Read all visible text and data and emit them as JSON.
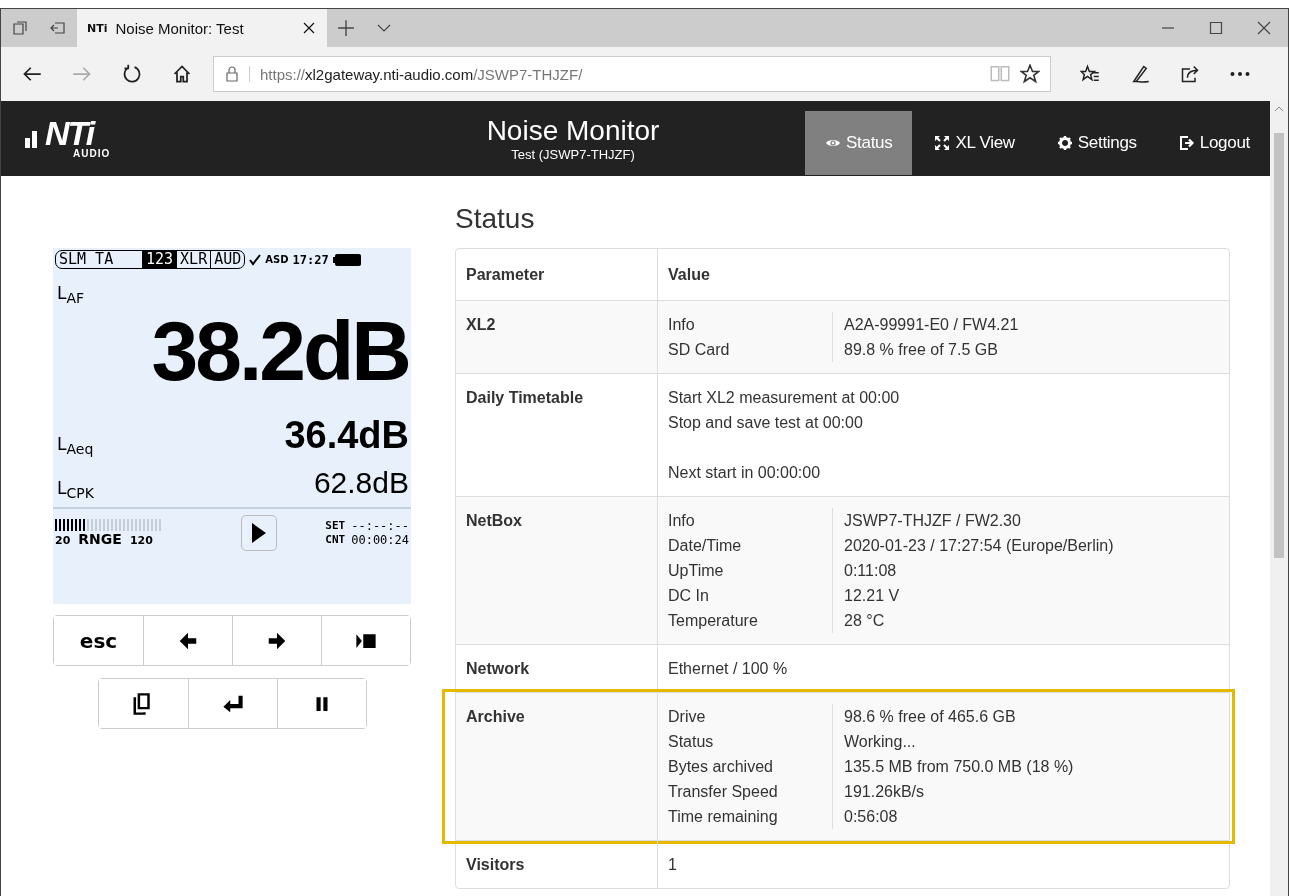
{
  "browser": {
    "tab_title": "Noise Monitor: Test",
    "tab_favicon": "NTi",
    "url": {
      "scheme": "https://",
      "host": "xl2gateway.nti-audio.com",
      "path": "/JSWP7-THJZF/"
    }
  },
  "header": {
    "logo": "NTi",
    "logo_sub": "AUDIO",
    "title": "Noise Monitor",
    "subtitle": "Test (JSWP7-THJZF)",
    "nav": [
      {
        "label": "Status",
        "kind": "eye",
        "selected": true
      },
      {
        "label": "XL View",
        "kind": "expand",
        "selected": false
      },
      {
        "label": "Settings",
        "kind": "gear",
        "selected": false
      },
      {
        "label": "Logout",
        "kind": "logout",
        "selected": false
      }
    ]
  },
  "device": {
    "status_segments": [
      {
        "label": "SLM TA",
        "selected": false
      },
      {
        "label": "123",
        "selected": true
      },
      {
        "label": "XLR",
        "selected": false
      },
      {
        "label": "AUD",
        "selected": false
      }
    ],
    "asd": "ASD",
    "clock": "17:27",
    "readings": [
      {
        "label": "L$_{AF}$",
        "value": "38.2dB",
        "kind": "primary"
      },
      {
        "label": "L$_{Aeq}$",
        "value": "36.4dB",
        "kind": "secondary"
      },
      {
        "label": "L$_{CPK}$",
        "value": "62.8dB",
        "kind": "tertiary"
      }
    ],
    "range": {
      "level": 0.3,
      "low": "20",
      "label": "RNGE",
      "high": "120"
    },
    "set_label": "SET",
    "set_value": "--:--:--",
    "cnt_label": "CNT",
    "cnt_value": "00:00:24",
    "keys": [
      {
        "kind": "text",
        "label": "esc"
      },
      {
        "kind": "left"
      },
      {
        "kind": "right"
      },
      {
        "kind": "play-stop"
      }
    ],
    "keys2": [
      {
        "kind": "copy"
      },
      {
        "kind": "enter"
      },
      {
        "kind": "pause"
      }
    ]
  },
  "page_title": "Status",
  "table": {
    "columns": [
      "Parameter",
      "Value"
    ],
    "rows": [
      {
        "parameter": "XL2",
        "kind": "pairs",
        "highlighted": false,
        "pairs": [
          {
            "key": "Info",
            "value": "A2A-99991-E0 / FW4.21"
          },
          {
            "key": "SD Card",
            "value": "89.8 % free of 7.5 GB"
          }
        ]
      },
      {
        "parameter": "Daily Timetable",
        "kind": "paragraphs",
        "highlighted": false,
        "paragraphs": [
          [
            "Start XL2 measurement at 00:00",
            "Stop and save test at 00:00"
          ],
          [
            "Next start in 00:00:00"
          ]
        ]
      },
      {
        "parameter": "NetBox",
        "kind": "pairs",
        "highlighted": false,
        "pairs": [
          {
            "key": "Info",
            "value": "JSWP7-THJZF / FW2.30"
          },
          {
            "key": "Date/Time",
            "value": "2020-01-23 / 17:27:54 (Europe/Berlin)"
          },
          {
            "key": "UpTime",
            "value": "0:11:08"
          },
          {
            "key": "DC In",
            "value": "12.21 V"
          },
          {
            "key": "Temperature",
            "value": "28 °C"
          }
        ]
      },
      {
        "parameter": "Network",
        "kind": "text",
        "highlighted": false,
        "text": "Ethernet / 100 %"
      },
      {
        "parameter": "Archive",
        "kind": "pairs",
        "highlighted": true,
        "pairs": [
          {
            "key": "Drive",
            "value": "98.6 % free of 465.6 GB"
          },
          {
            "key": "Status",
            "value": "Working..."
          },
          {
            "key": "Bytes archived",
            "value": "135.5 MB from 750.0 MB (18 %)"
          },
          {
            "key": "Transfer Speed",
            "value": "191.26kB/s"
          },
          {
            "key": "Time remaining",
            "value": "0:56:08"
          }
        ]
      },
      {
        "parameter": "Visitors",
        "kind": "text",
        "highlighted": false,
        "text": "1"
      }
    ]
  }
}
